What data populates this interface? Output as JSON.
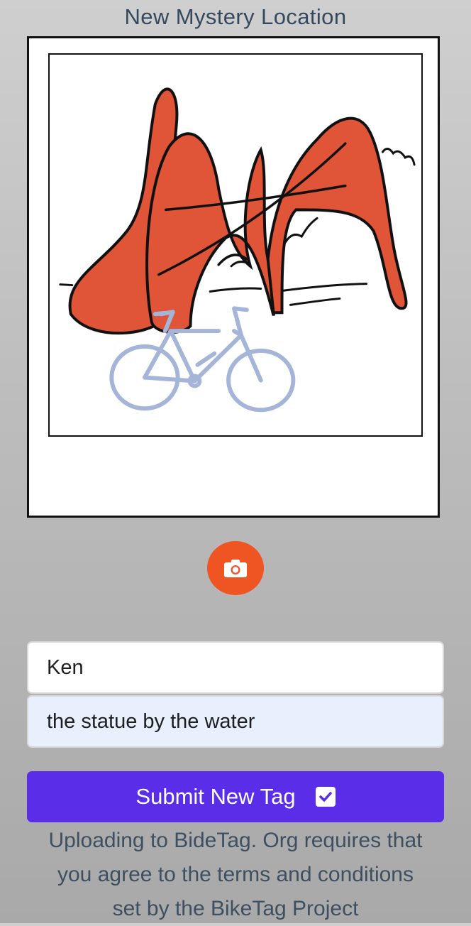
{
  "header": {
    "title": "New Mystery Location"
  },
  "photo": {
    "description_icon": "bridge-and-bike-illustration",
    "colors": {
      "bridge": "#e05438",
      "bike": "#a4b5d8",
      "ink": "#111111"
    }
  },
  "camera": {
    "icon": "camera-icon",
    "color": "#ee5522"
  },
  "form": {
    "name_value": "Ken",
    "hint_value": "the statue by the water"
  },
  "submit": {
    "label": "Submit New Tag",
    "checked": true,
    "color": "#5a2de8"
  },
  "notice": {
    "line1": "Uploading to BideTag. Org requires that",
    "line2": "you agree to the terms and conditions",
    "line3": "set by the BikeTag Project"
  }
}
